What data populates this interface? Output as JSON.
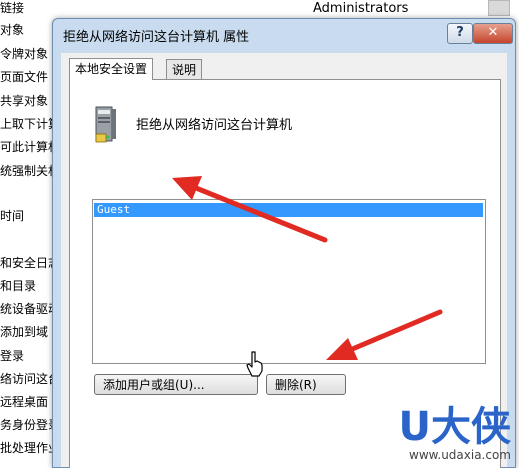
{
  "background": {
    "items": [
      "链接",
      "对象",
      "令牌对象",
      "页面文件",
      "共享对象",
      "上取下计算",
      "可此计算机",
      "统强制关机",
      "时间",
      "和安全日志",
      "和目录",
      "统设备驱动",
      "添加到域",
      "登录",
      "络访问这台",
      "远程桌面",
      "务身份登录",
      "批处理作业"
    ],
    "admin_label": "Administrators"
  },
  "dialog": {
    "title": "拒绝从网络访问这台计算机 属性",
    "help_glyph": "?",
    "close_glyph": "✕",
    "tabs": [
      "本地安全设置",
      "说明"
    ],
    "policy_name": "拒绝从网络访问这台计算机",
    "list_items": [
      "Guest"
    ],
    "add_button": "添加用户或组(U)...",
    "remove_button": "删除(R)"
  },
  "watermark": {
    "logo": "U大侠",
    "url": "www.udaxia.com"
  },
  "colors": {
    "selection": "#3399ff",
    "arrow": "#e02a22",
    "logo": "#2a64c8"
  }
}
